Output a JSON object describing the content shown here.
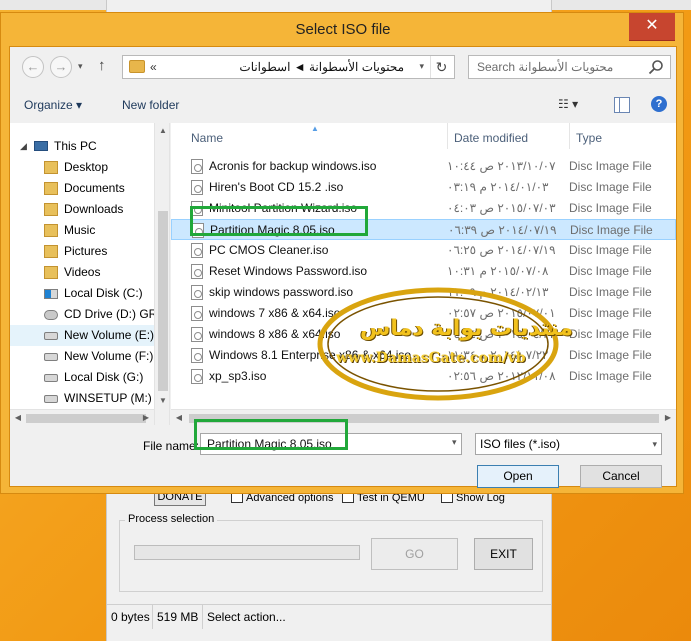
{
  "dialog": {
    "title": "Select ISO file",
    "close_glyph": "✕"
  },
  "address_bar": {
    "breadcrumb_chevron": "«",
    "path": "محتويات الأسطوانة  ◄  اسطوانات",
    "refresh_glyph": "↻"
  },
  "search": {
    "placeholder": "Search محتويات الأسطوانة"
  },
  "toolbar": {
    "organize_label": "Organize ▾",
    "new_folder_label": "New folder",
    "view_glyph": "☷ ▾",
    "help_glyph": "?"
  },
  "nav": {
    "items": [
      {
        "label": "This PC",
        "icon": "computer-icon"
      },
      {
        "label": "Desktop",
        "icon": "folder-icon"
      },
      {
        "label": "Documents",
        "icon": "folder-icon"
      },
      {
        "label": "Downloads",
        "icon": "folder-icon"
      },
      {
        "label": "Music",
        "icon": "folder-icon"
      },
      {
        "label": "Pictures",
        "icon": "folder-icon"
      },
      {
        "label": "Videos",
        "icon": "folder-icon"
      },
      {
        "label": "Local Disk (C:)",
        "icon": "windows-drive-icon"
      },
      {
        "label": "CD Drive (D:) GRT",
        "icon": "cd-drive-icon"
      },
      {
        "label": "New Volume (E:)",
        "icon": "drive-icon",
        "selected": true
      },
      {
        "label": "New Volume (F:)",
        "icon": "drive-icon"
      },
      {
        "label": "Local Disk (G:)",
        "icon": "drive-icon"
      },
      {
        "label": "WINSETUP (M:)",
        "icon": "drive-icon"
      }
    ]
  },
  "files": {
    "columns": [
      "Name",
      "Date modified",
      "Type"
    ],
    "rows": [
      {
        "name": "Acronis for backup windows.iso",
        "date": "٢٠١٣/١٠/٠٧ ص ١٠:٤٤",
        "type": "Disc Image File"
      },
      {
        "name": "Hiren's Boot CD 15.2 .iso",
        "date": "٢٠١٤/٠١/٠٣ م ٠٣:١٩",
        "type": "Disc Image File"
      },
      {
        "name": "Minitool Partition Wizard.iso",
        "date": "٢٠١٥/٠٧/٠٣ ص ٠٤:٠٣",
        "type": "Disc Image File"
      },
      {
        "name": "Partition Magic 8.05.iso",
        "date": "٢٠١٤/٠٧/١٩ ص ٠٦:٣٩",
        "type": "Disc Image File",
        "selected": true
      },
      {
        "name": "PC CMOS Cleaner.iso",
        "date": "٢٠١٤/٠٧/١٩ ص ٠٦:٢٥",
        "type": "Disc Image File"
      },
      {
        "name": "Reset Windows Password.iso",
        "date": "٢٠١٥/٠٧/٠٨ م ١٠:٣١",
        "type": "Disc Image File"
      },
      {
        "name": "skip windows password.iso",
        "date": "٢٠١٤/٠٢/١٣ م ١١:٠٩",
        "type": "Disc Image File"
      },
      {
        "name": "windows 7 x86 & x64.iso",
        "date": "٢٠١٥/٠٧/٠١ ص ٠٢:٥٧",
        "type": "Disc Image File"
      },
      {
        "name": "windows 8 x86 & x64.iso",
        "date": "٢٠١٥/٠٤/٢٢ ص ٠٤:١٤",
        "type": "Disc Image File"
      },
      {
        "name": "Windows 8.1 Enterprise x86 & x64.iso",
        "date": "٢٠١٤/٠٧/٢٢ م ١١:٣٤",
        "type": "Disc Image File"
      },
      {
        "name": "xp_sp3.iso",
        "date": "٢٠١٢/١١/٠٨ ص ٠٢:٥٦",
        "type": "Disc Image File"
      }
    ]
  },
  "bottom": {
    "file_name_label": "File name:",
    "file_name_value": "Partition Magic 8.05.iso",
    "file_type": "ISO files (*.iso)",
    "open_label": "Open",
    "cancel_label": "Cancel"
  },
  "watermark": {
    "line1": "منتديات بوابة دماس",
    "line2": "www.DamasGate.com/vb"
  },
  "background_app": {
    "donate_label": "DONATE",
    "advanced_options_label": "Advanced options",
    "test_qemu_label": "Test in QEMU",
    "show_log_label": "Show Log",
    "process_selection_label": "Process selection",
    "go_label": "GO",
    "exit_label": "EXIT",
    "status": [
      "0 bytes",
      "519 MB",
      "Select action..."
    ]
  },
  "colors": {
    "desktop_orange": "#f3a11e",
    "dialog_frame": "#f5b538",
    "selection": "#cce8ff",
    "highlight_green": "#21a83a",
    "close_red": "#c7452f"
  }
}
